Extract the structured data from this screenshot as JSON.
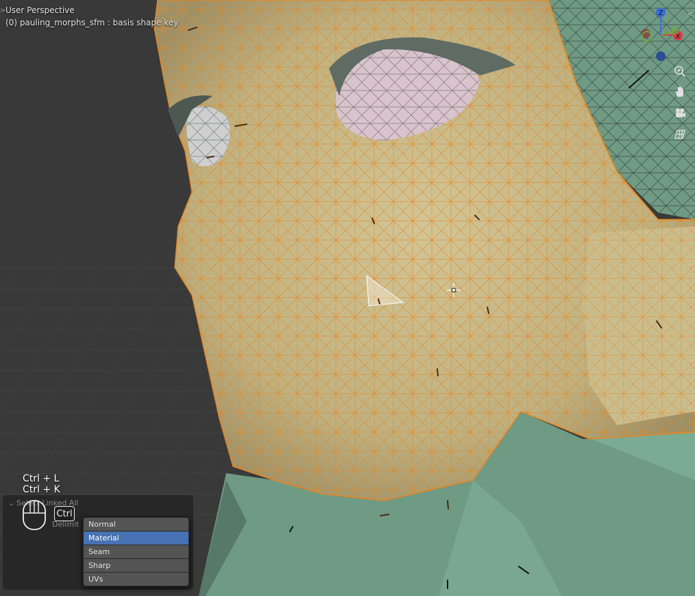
{
  "viewport": {
    "title": "User Perspective",
    "object_label": "(0) pauling_morphs_sfm : basis shape key"
  },
  "gizmo": {
    "z_label": "Z",
    "x_label": "X"
  },
  "nav_buttons": [
    "zoom-icon",
    "hand-pan-icon",
    "camera-icon",
    "grid-ortho-icon"
  ],
  "shortcuts": [
    "Ctrl + L",
    "Ctrl + K"
  ],
  "key_hint": {
    "key": "Ctrl"
  },
  "operator_panel": {
    "title": "Select Linked All",
    "delimit_label": "Delimit",
    "options": [
      "Normal",
      "Material",
      "Seam",
      "Sharp",
      "UVs"
    ],
    "selected": "Material"
  },
  "colors": {
    "wire": "#e8851e",
    "skin": "#c9bd8e",
    "clothing": "#6f9a84",
    "selection": "#4772b3"
  }
}
